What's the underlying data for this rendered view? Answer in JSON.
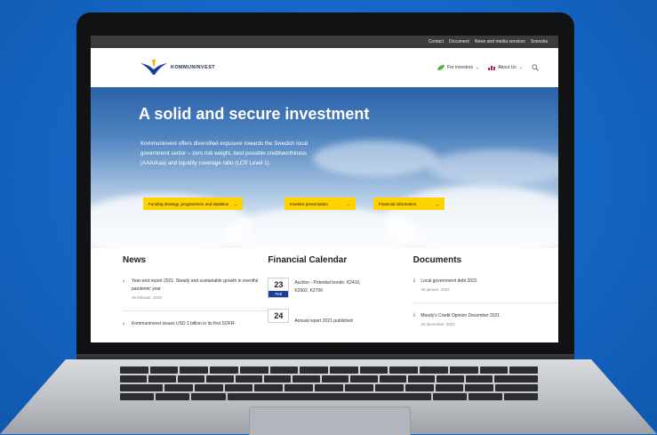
{
  "topbar": {
    "links": [
      "Contact",
      "Document",
      "News and media services",
      "Svenska"
    ]
  },
  "nav": {
    "logo_text": "KOMMUNINVEST",
    "items": [
      {
        "label": "For investors"
      },
      {
        "label": "About Us"
      }
    ]
  },
  "hero": {
    "title": "A solid and secure investment",
    "body": "Kommuninvest offers diversified exposure towards the Swedish local government sector – zero risk weight, best possible creditworthiness (AAA/Aaa) and liquidity coverage ratio (LCR Level 1).",
    "buttons": [
      "Funding strategy, programmes and statistics",
      "Investor presentation",
      "Financial information"
    ]
  },
  "news": {
    "title": "News",
    "items": [
      {
        "text": "Year-end report 2021: Steady and sustainable growth in eventful pandemic year",
        "date": "15 februari, 2022"
      },
      {
        "text": "Kommuninvest issues USD 1 billion in its first SOFR-"
      }
    ]
  },
  "calendar": {
    "title": "Financial Calendar",
    "items": [
      {
        "day": "23",
        "month": "Feb",
        "text": "Auction - Potential bonds: K2410, K2602, K2706"
      },
      {
        "day": "24",
        "text": "Annual report 2021 published"
      }
    ]
  },
  "documents": {
    "title": "Documents",
    "items": [
      {
        "text": "Local government debt 2021",
        "date": "26 januari, 2022"
      },
      {
        "text": "Moody's Credit Opinion December 2021",
        "date": "29 december, 2021"
      }
    ]
  },
  "colors": {
    "brand_blue": "#1a3e9b",
    "cta_yellow": "#ffd200",
    "background": "#1565c0"
  },
  "icons": [
    "leaf-icon",
    "chart-icon",
    "search-icon",
    "download-icon"
  ]
}
